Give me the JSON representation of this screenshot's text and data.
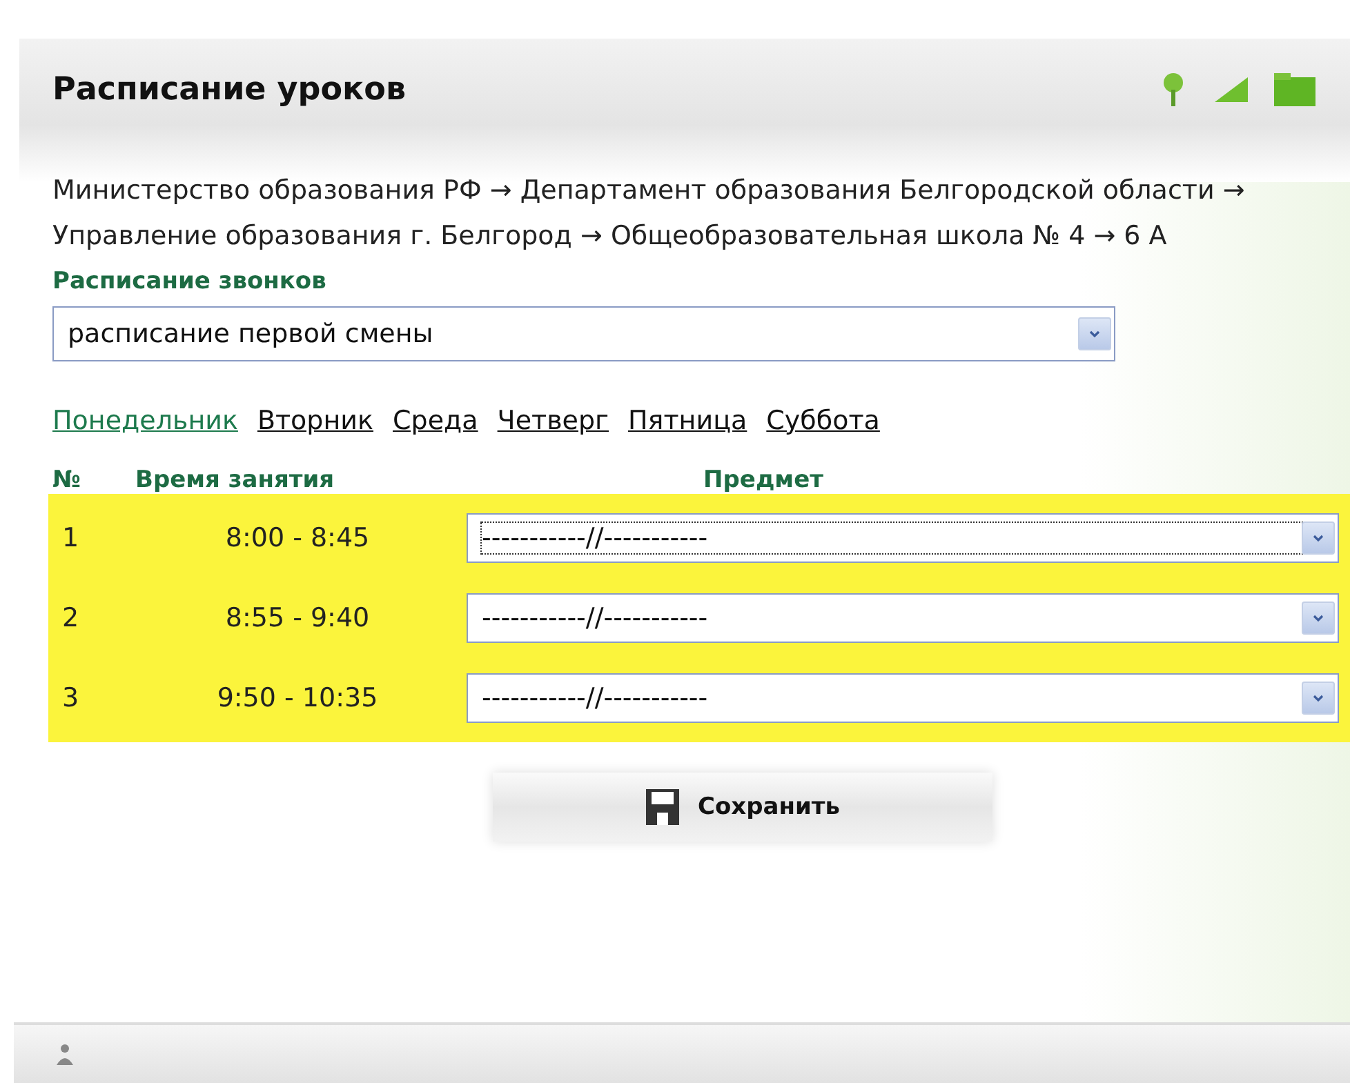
{
  "window": {
    "title": "Расписание уроков"
  },
  "breadcrumb": "Министерство образования РФ → Департамент образования Белгородской области → Управление образования г. Белгород → Общеобразовательная школа № 4 → 6 А",
  "bell_schedule": {
    "label": "Расписание звонков",
    "value": "расписание первой смены"
  },
  "tabs": [
    {
      "label": "Понедельник",
      "selected": true
    },
    {
      "label": "Вторник",
      "selected": false
    },
    {
      "label": "Среда",
      "selected": false
    },
    {
      "label": "Четверг",
      "selected": false
    },
    {
      "label": "Пятница",
      "selected": false
    },
    {
      "label": "Суббота",
      "selected": false
    }
  ],
  "table": {
    "columns": [
      "№",
      "Время занятия",
      "Предмет"
    ],
    "rows": [
      {
        "number": "1",
        "time": "8:00 - 8:45",
        "subject": "-----------//-----------",
        "focused": true
      },
      {
        "number": "2",
        "time": "8:55 - 9:40",
        "subject": "-----------//-----------",
        "focused": false
      },
      {
        "number": "3",
        "time": "9:50 - 10:35",
        "subject": "-----------//-----------",
        "focused": false
      }
    ]
  },
  "save_button": "Сохранить"
}
